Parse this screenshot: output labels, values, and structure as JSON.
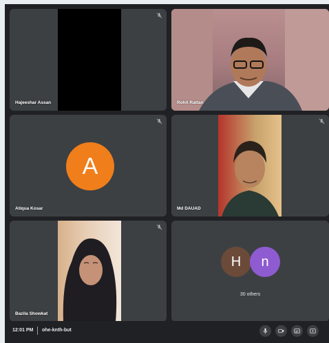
{
  "participants": [
    {
      "name": "Hajeeshar Assan"
    },
    {
      "name": "Rohit Rattan"
    },
    {
      "name": "Atiqua Kosar",
      "avatar_letter": "A",
      "avatar_color": "#f07e1b"
    },
    {
      "name": "Md DAUAD"
    },
    {
      "name": "Bazila Showkat"
    }
  ],
  "others_tile": {
    "avatars": [
      {
        "letter": "H",
        "color": "#6b4a3a"
      },
      {
        "letter": "n",
        "color": "#8e5bd0"
      }
    ],
    "label": "30 others"
  },
  "bottom_bar": {
    "time": "12:01 PM",
    "meeting_code": "ohe-knth-but",
    "icons": [
      "mic-icon",
      "camera-icon",
      "captions-icon",
      "present-icon"
    ]
  },
  "colors": {
    "background": "#202124",
    "tile": "#3c4043",
    "accent_orange": "#f07e1b",
    "accent_purple": "#8e5bd0"
  }
}
